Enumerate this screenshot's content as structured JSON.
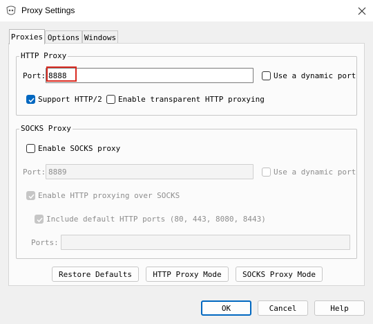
{
  "window": {
    "title": "Proxy Settings",
    "app_icon": "proxy-app-icon",
    "close_icon": "close-icon"
  },
  "tabs": [
    {
      "label": "Proxies",
      "active": true
    },
    {
      "label": "Options",
      "active": false
    },
    {
      "label": "Windows",
      "active": false
    }
  ],
  "http_proxy": {
    "group_label": "HTTP Proxy",
    "port_label": "Port:",
    "port_value": "8888",
    "dynamic_port_label": "Use a dynamic port",
    "dynamic_port_checked": false,
    "http2_label": "Support HTTP/2",
    "http2_checked": true,
    "transparent_label": "Enable transparent HTTP proxying",
    "transparent_checked": false
  },
  "socks_proxy": {
    "group_label": "SOCKS Proxy",
    "enable_label": "Enable SOCKS proxy",
    "enable_checked": false,
    "port_label": "Port:",
    "port_value": "8889",
    "dynamic_port_label": "Use a dynamic port",
    "http_over_socks_label": "Enable HTTP proxying over SOCKS",
    "http_over_socks_checked": true,
    "include_ports_label": "Include default HTTP ports (80, 443, 8080, 8443)",
    "include_ports_checked": true,
    "ports_label": "Ports:",
    "ports_value": ""
  },
  "mode_buttons": {
    "restore": "Restore Defaults",
    "http_mode": "HTTP Proxy Mode",
    "socks_mode": "SOCKS Proxy Mode"
  },
  "dialog_buttons": {
    "ok": "OK",
    "cancel": "Cancel",
    "help": "Help"
  },
  "colors": {
    "accent": "#0067c0",
    "highlight": "#d9291f",
    "disabled_text": "#8d8d8d"
  }
}
